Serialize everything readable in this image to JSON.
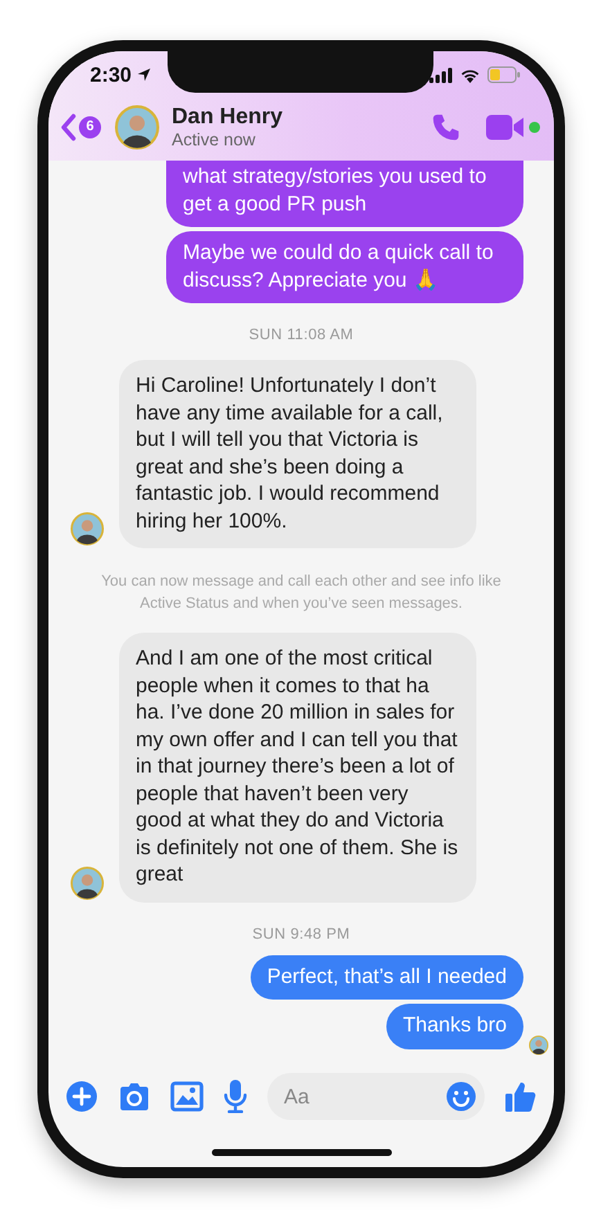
{
  "status_bar": {
    "time": "2:30"
  },
  "header": {
    "back_badge": "6",
    "name": "Dan Henry",
    "status": "Active now",
    "online": true
  },
  "messages": [
    {
      "kind": "sent",
      "text": "what strategy/stories you used to get a good PR push",
      "color": "#9a42ee",
      "cut": true
    },
    {
      "kind": "sent",
      "text": "Maybe we could do a quick call to discuss? Appreciate you 🙏",
      "color": "#9a42ee",
      "cut": false
    },
    {
      "kind": "time",
      "text": "SUN 11:08 AM"
    },
    {
      "kind": "received",
      "text": "Hi Caroline! Unfortunately I don’t have any time available for a call, but I will tell you that Victoria is great and she’s been doing a fantastic job. I would recommend hiring her 100%.",
      "avatar": true
    },
    {
      "kind": "notice",
      "text": "You can now message and call each other and see info like Active Status and when you’ve seen messages."
    },
    {
      "kind": "received",
      "text": "And I am one of the most critical people when it comes to that ha ha. I’ve done 20 million in sales for my own offer and I can tell you that in that journey there’s been a lot of people that haven’t been very good at what they do and Victoria is definitely not one of them. She is great",
      "avatar": true
    },
    {
      "kind": "time",
      "text": "SUN 9:48 PM"
    },
    {
      "kind": "sent",
      "text": "Perfect, that’s all I needed",
      "color": "#3a80f6",
      "cut": false,
      "seen": false
    },
    {
      "kind": "sent",
      "text": "Thanks bro",
      "color": "#3a80f6",
      "cut": false,
      "seen": true
    }
  ],
  "composer": {
    "placeholder": "Aa"
  }
}
